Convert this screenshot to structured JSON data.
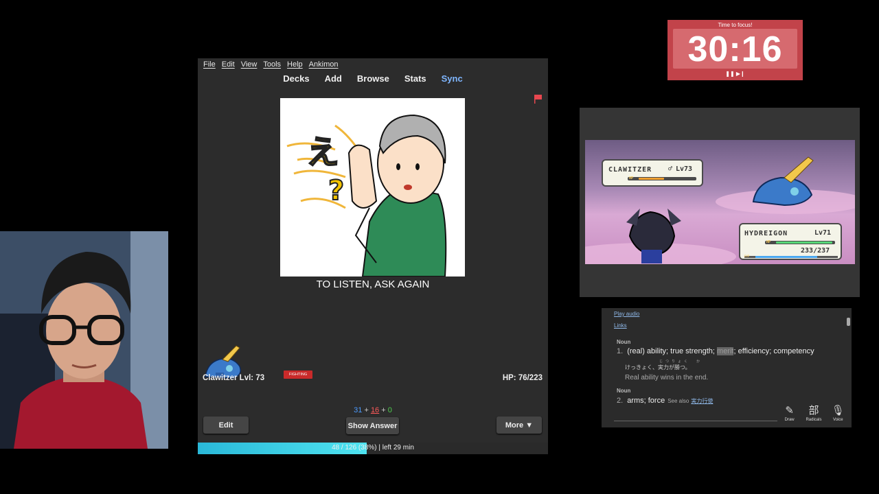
{
  "anki": {
    "menu": [
      "File",
      "Edit",
      "View",
      "Tools",
      "Help",
      "Ankimon"
    ],
    "toplinks": [
      "Decks",
      "Add",
      "Browse",
      "Stats",
      "Sync"
    ],
    "card_text": "TO LISTEN, ASK AGAIN",
    "pet_label": "Clawitzer Lvl: 73",
    "type_badge": "FIGHTING",
    "hp_label": "HP: 76/223",
    "counts": {
      "new": "31",
      "learn": "16",
      "review": "0",
      "sep": " + "
    },
    "buttons": {
      "edit": "Edit",
      "show_answer": "Show Answer",
      "more": "More ▼"
    },
    "progress": {
      "fraction": 0.38,
      "text": "48 / 126 (38%) | left 29 min"
    },
    "flag_color": "#e8474f",
    "sync_color": "#7fb6ff"
  },
  "timer": {
    "label": "Time to focus!",
    "value": "30:16",
    "controls": "❚❚ ▶❙",
    "color": "#c2434a"
  },
  "battle": {
    "enemy": {
      "name": "CLAWITZER",
      "gender": "♂",
      "level": "Lv73",
      "hp_fraction": 0.45
    },
    "player": {
      "name": "HYDREIGON",
      "level": "Lv71",
      "hp_current": "233",
      "hp_max": "237",
      "hp_fraction": 0.98
    },
    "hp_tag": "HP",
    "exp_tag": "EXP"
  },
  "dictionary": {
    "play_audio": "Play audio",
    "links": "Links",
    "senses": [
      {
        "pos": "Noun",
        "num": "1.",
        "pre": "(real) ability; true strength; ",
        "highlight": "merit",
        "post": "; efficiency; competency"
      },
      {
        "pos": "Noun",
        "num": "2.",
        "pre": "arms; force",
        "see_also_label": "See also",
        "see_also_link": "実力行使"
      }
    ],
    "furigana": "じつりょく　か",
    "example_jp": "けっきょく、実力が勝つ。",
    "example_en": "Real ability wins in the end.",
    "tools": [
      {
        "glyph": "✎",
        "label": "Draw",
        "icon": "draw-icon"
      },
      {
        "glyph": "部",
        "label": "Radicals",
        "icon": "radicals-icon"
      },
      {
        "glyph": "🎙",
        "label": "Voice",
        "icon": "voice-icon"
      }
    ]
  }
}
